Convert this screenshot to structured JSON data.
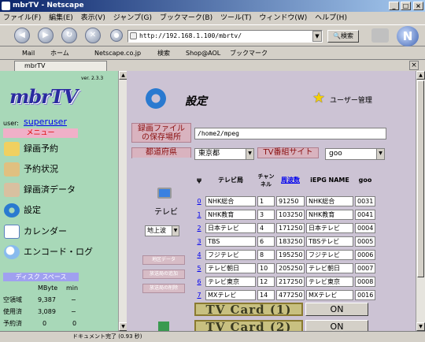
{
  "window": {
    "title": "mbrTV - Netscape",
    "buttons": [
      "_",
      "□",
      "×"
    ]
  },
  "menu": [
    "ファイル(F)",
    "編集(E)",
    "表示(V)",
    "ジャンプ(G)",
    "ブックマーク(B)",
    "ツール(T)",
    "ウィンドウ(W)",
    "ヘルプ(H)"
  ],
  "nav": {
    "url": "http://192.168.1.100/mbrtv/",
    "search_label": "検索",
    "logo_letter": "N"
  },
  "bookmarks": [
    "Mail",
    "ホーム",
    "Netscape.co.jp",
    "検索",
    "Shop@AOL",
    "ブックマーク"
  ],
  "tab": {
    "label": "mbrTV"
  },
  "sidebar": {
    "logo": "mbrTV",
    "version": "ver. 2.3.3",
    "user_label": "user:",
    "username": "superuser",
    "menu_header": "メニュー",
    "items": [
      {
        "label": "録画予約",
        "icon": "pencil-icon",
        "color": "#f0d060"
      },
      {
        "label": "予約状況",
        "icon": "edit-icon",
        "color": "#e0c080"
      },
      {
        "label": "録画済データ",
        "icon": "list-icon",
        "color": "#d8c0a0"
      },
      {
        "label": "設定",
        "icon": "gear-icon",
        "color": "#2a7ad0"
      },
      {
        "label": "カレンダー",
        "icon": "calendar-icon",
        "color": "#a0c8ff"
      },
      {
        "label": "エンコード・ログ",
        "icon": "magnifier-icon",
        "color": "#88bbee"
      }
    ],
    "disk": {
      "header": "ディスク スペース",
      "col_mbyte": "MByte",
      "col_min": "min",
      "rows": [
        {
          "label": "空領域",
          "mbyte": "9,387",
          "min": "−"
        },
        {
          "label": "使用済",
          "mbyte": "3,089",
          "min": "−"
        },
        {
          "label": "予約済",
          "mbyte": "0",
          "min": "0"
        }
      ]
    }
  },
  "main": {
    "title": "設定",
    "user_mgmt": "ユーザー管理",
    "save_label": "録画ファイル\nの保存場所",
    "save_path": "/home2/mpeg",
    "pref_label": "都道府県",
    "pref_value": "東京都",
    "site_label": "TV番組サイト",
    "site_value": "goo",
    "tv_label": "テレビ",
    "ground_value": "地上波",
    "side_buttons": [
      "地区データ",
      "放送局の追加",
      "放送局の削除"
    ],
    "table": {
      "headers": [
        "ψ",
        "テレビ局",
        "チャンネル",
        "周波数",
        "iEPG NAME",
        "goo"
      ],
      "rows": [
        {
          "no": "0",
          "station": "NHK総合",
          "ch": "1",
          "freq": "91250",
          "iepg": "NHK総合",
          "goo": "0031"
        },
        {
          "no": "1",
          "station": "NHK教育",
          "ch": "3",
          "freq": "103250",
          "iepg": "NHK教育",
          "goo": "0041"
        },
        {
          "no": "2",
          "station": "日本テレビ",
          "ch": "4",
          "freq": "171250",
          "iepg": "日本テレビ",
          "goo": "0004"
        },
        {
          "no": "3",
          "station": "TBS",
          "ch": "6",
          "freq": "183250",
          "iepg": "TBSテレビ",
          "goo": "0005"
        },
        {
          "no": "4",
          "station": "フジテレビ",
          "ch": "8",
          "freq": "195250",
          "iepg": "フジテレビ",
          "goo": "0006"
        },
        {
          "no": "5",
          "station": "テレビ朝日",
          "ch": "10",
          "freq": "205250",
          "iepg": "テレビ朝日",
          "goo": "0007"
        },
        {
          "no": "6",
          "station": "テレビ東京",
          "ch": "12",
          "freq": "217250",
          "iepg": "テレビ東京",
          "goo": "0008"
        },
        {
          "no": "7",
          "station": "MXテレビ",
          "ch": "14",
          "freq": "477250",
          "iepg": "MXテレビ",
          "goo": "0016"
        }
      ]
    },
    "cards": [
      {
        "label": "TV Card (1)",
        "state": "ON"
      },
      {
        "label": "TV Card (2)",
        "state": "ON"
      }
    ]
  },
  "status": "ドキュメント完了 (0.93 秒)"
}
